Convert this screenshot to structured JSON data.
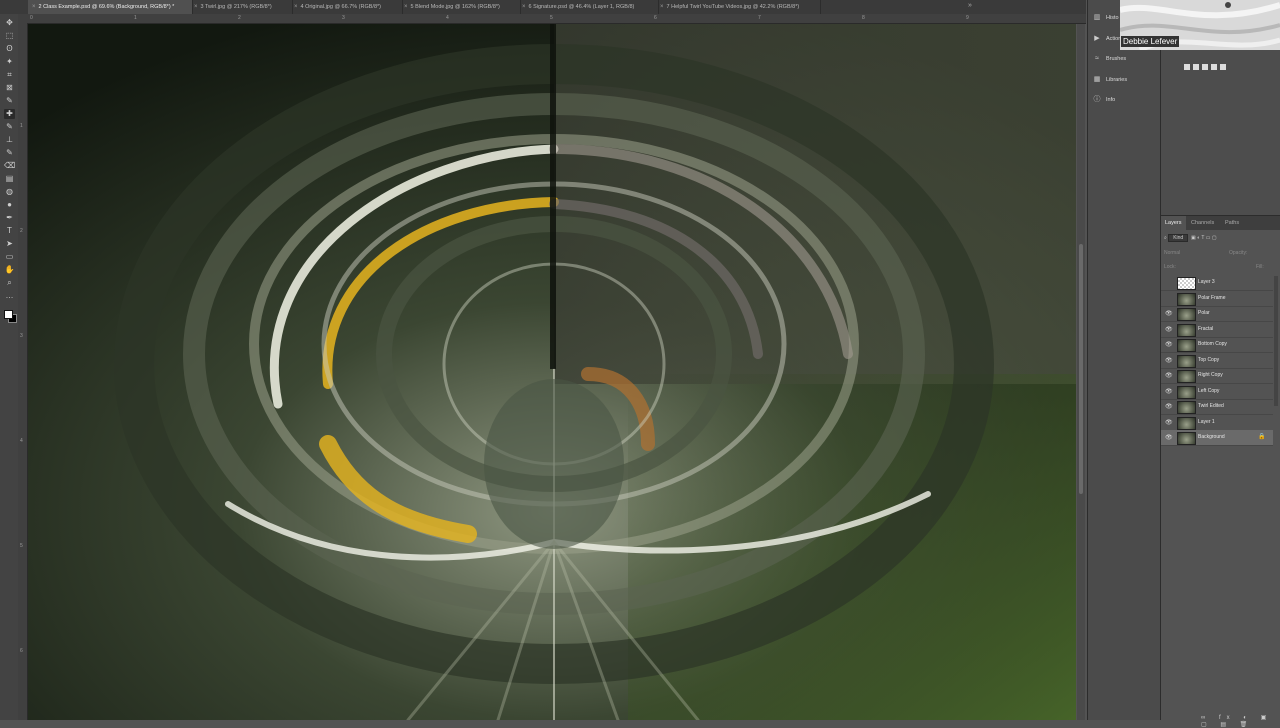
{
  "tabs": [
    {
      "label": "2 Class Example.psd @ 69.6% (Background, RGB/8*) *",
      "active": true
    },
    {
      "label": "3 Twirl.jpg @ 217% (RGB/8*)",
      "active": false
    },
    {
      "label": "4 Original.jpg @ 66.7% (RGB/8*)",
      "active": false
    },
    {
      "label": "5 Blend Mode.jpg @ 162% (RGB/8*)",
      "active": false
    },
    {
      "label": "6 Signature.psd @ 46.4% (Layer 1, RGB/8)",
      "active": false
    },
    {
      "label": "7 Helpful Twirl YouTube Videos.jpg @ 42.2% (RGB/8*)",
      "active": false
    }
  ],
  "tabs_collapse_glyph": "»",
  "tools": [
    "move-icon",
    "marquee-icon",
    "lasso-icon",
    "magic-wand-icon",
    "crop-icon",
    "frame-icon",
    "eyedropper-icon",
    "healing-brush-icon",
    "brush-icon",
    "clone-stamp-icon",
    "history-brush-icon",
    "eraser-icon",
    "gradient-icon",
    "blur-icon",
    "dodge-icon",
    "pen-icon",
    "type-icon",
    "path-select-icon",
    "rectangle-icon",
    "hand-icon",
    "zoom-icon",
    "more-icon"
  ],
  "tool_glyphs": [
    "✥",
    "⬚",
    "ʘ",
    "✦",
    "⌗",
    "⊠",
    "✎",
    "✚",
    "✎",
    "⊥",
    "✎",
    "⌫",
    "▤",
    "◍",
    "●",
    "✒",
    "T",
    "➤",
    "▭",
    "✋",
    "⌕",
    "…"
  ],
  "ruler": {
    "top": [
      "0",
      "1",
      "2",
      "3",
      "4",
      "5",
      "6",
      "7",
      "8",
      "9"
    ],
    "left": [
      "1",
      "2",
      "3",
      "4",
      "5",
      "6"
    ]
  },
  "panel_icons": [
    {
      "label": "Histo",
      "glyph": "▥",
      "icon": "histogram-icon"
    },
    {
      "label": "Action",
      "glyph": "▶",
      "icon": "actions-icon"
    },
    {
      "label": "Brushes",
      "glyph": "≈",
      "icon": "brushes-icon"
    },
    {
      "label": "Libraries",
      "glyph": "▦",
      "icon": "libraries-icon"
    },
    {
      "label": "Info",
      "glyph": "ⓘ",
      "icon": "info-icon"
    }
  ],
  "webcam": {
    "name": "Debbie Lefever"
  },
  "layers_panel": {
    "tabs": [
      "Layers",
      "Channels",
      "Paths"
    ],
    "filter_kind": "Kind",
    "blend_mode": "Normal",
    "opacity_label": "Opacity:",
    "lock_label": "Lock:",
    "fill_label": "Fill:",
    "layers": [
      {
        "name": "Layer 3",
        "visible": false,
        "locked": false,
        "selected": false
      },
      {
        "name": "Polar Frame",
        "visible": false,
        "locked": false,
        "selected": false
      },
      {
        "name": "Polar",
        "visible": true,
        "locked": false,
        "selected": false
      },
      {
        "name": "Fractal",
        "visible": true,
        "locked": false,
        "selected": false
      },
      {
        "name": "Bottom Copy",
        "visible": true,
        "locked": false,
        "selected": false
      },
      {
        "name": "Top Copy",
        "visible": true,
        "locked": false,
        "selected": false
      },
      {
        "name": "Right Copy",
        "visible": true,
        "locked": false,
        "selected": false
      },
      {
        "name": "Left Copy",
        "visible": true,
        "locked": false,
        "selected": false
      },
      {
        "name": "Twirl Edited",
        "visible": true,
        "locked": false,
        "selected": false
      },
      {
        "name": "Layer 1",
        "visible": true,
        "locked": false,
        "selected": false
      },
      {
        "name": "Background",
        "visible": true,
        "locked": true,
        "selected": true
      }
    ],
    "footer_glyphs": "∞ fx ◐ ▣ ▢ ▤ 🗑"
  },
  "colors": {
    "accent_yellow": "#e6b41e",
    "art_dark": "#151a12",
    "art_green": "#4a6a2a",
    "art_pale": "#e8eadc"
  }
}
